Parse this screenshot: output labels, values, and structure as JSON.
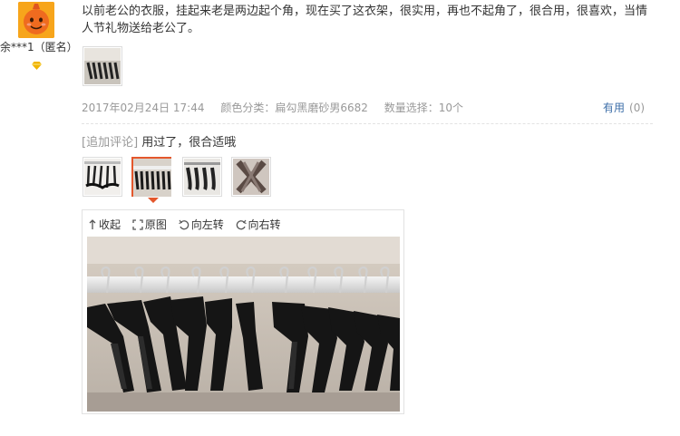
{
  "user": {
    "name": "余***1（匿名）",
    "avatar_icon": "carrot-mascot-avatar",
    "vip_icon": "diamond-icon",
    "vip_color": "#f0b400"
  },
  "review": {
    "text": "以前老公的衣服，挂起来老是两边起个角，现在买了这衣架，很实用，再也不起角了，很合用，很喜欢，当情人节礼物送给老公了。"
  },
  "meta": {
    "date": "2017年02月24日 17:44",
    "color_label": "颜色分类：",
    "color_value": "扁勾黑磨砂男6682",
    "qty_label": "数量选择：",
    "qty_value": "10个",
    "helpful_label": "有用",
    "helpful_count": "(0)",
    "link_color": "#3c6ea8"
  },
  "followup": {
    "tag": "[追加评论]",
    "text": "用过了，很合适哦"
  },
  "viewer": {
    "collapse": "收起",
    "original": "原图",
    "rotate_left": "向左转",
    "rotate_right": "向右转",
    "accent": "#e4572c"
  }
}
